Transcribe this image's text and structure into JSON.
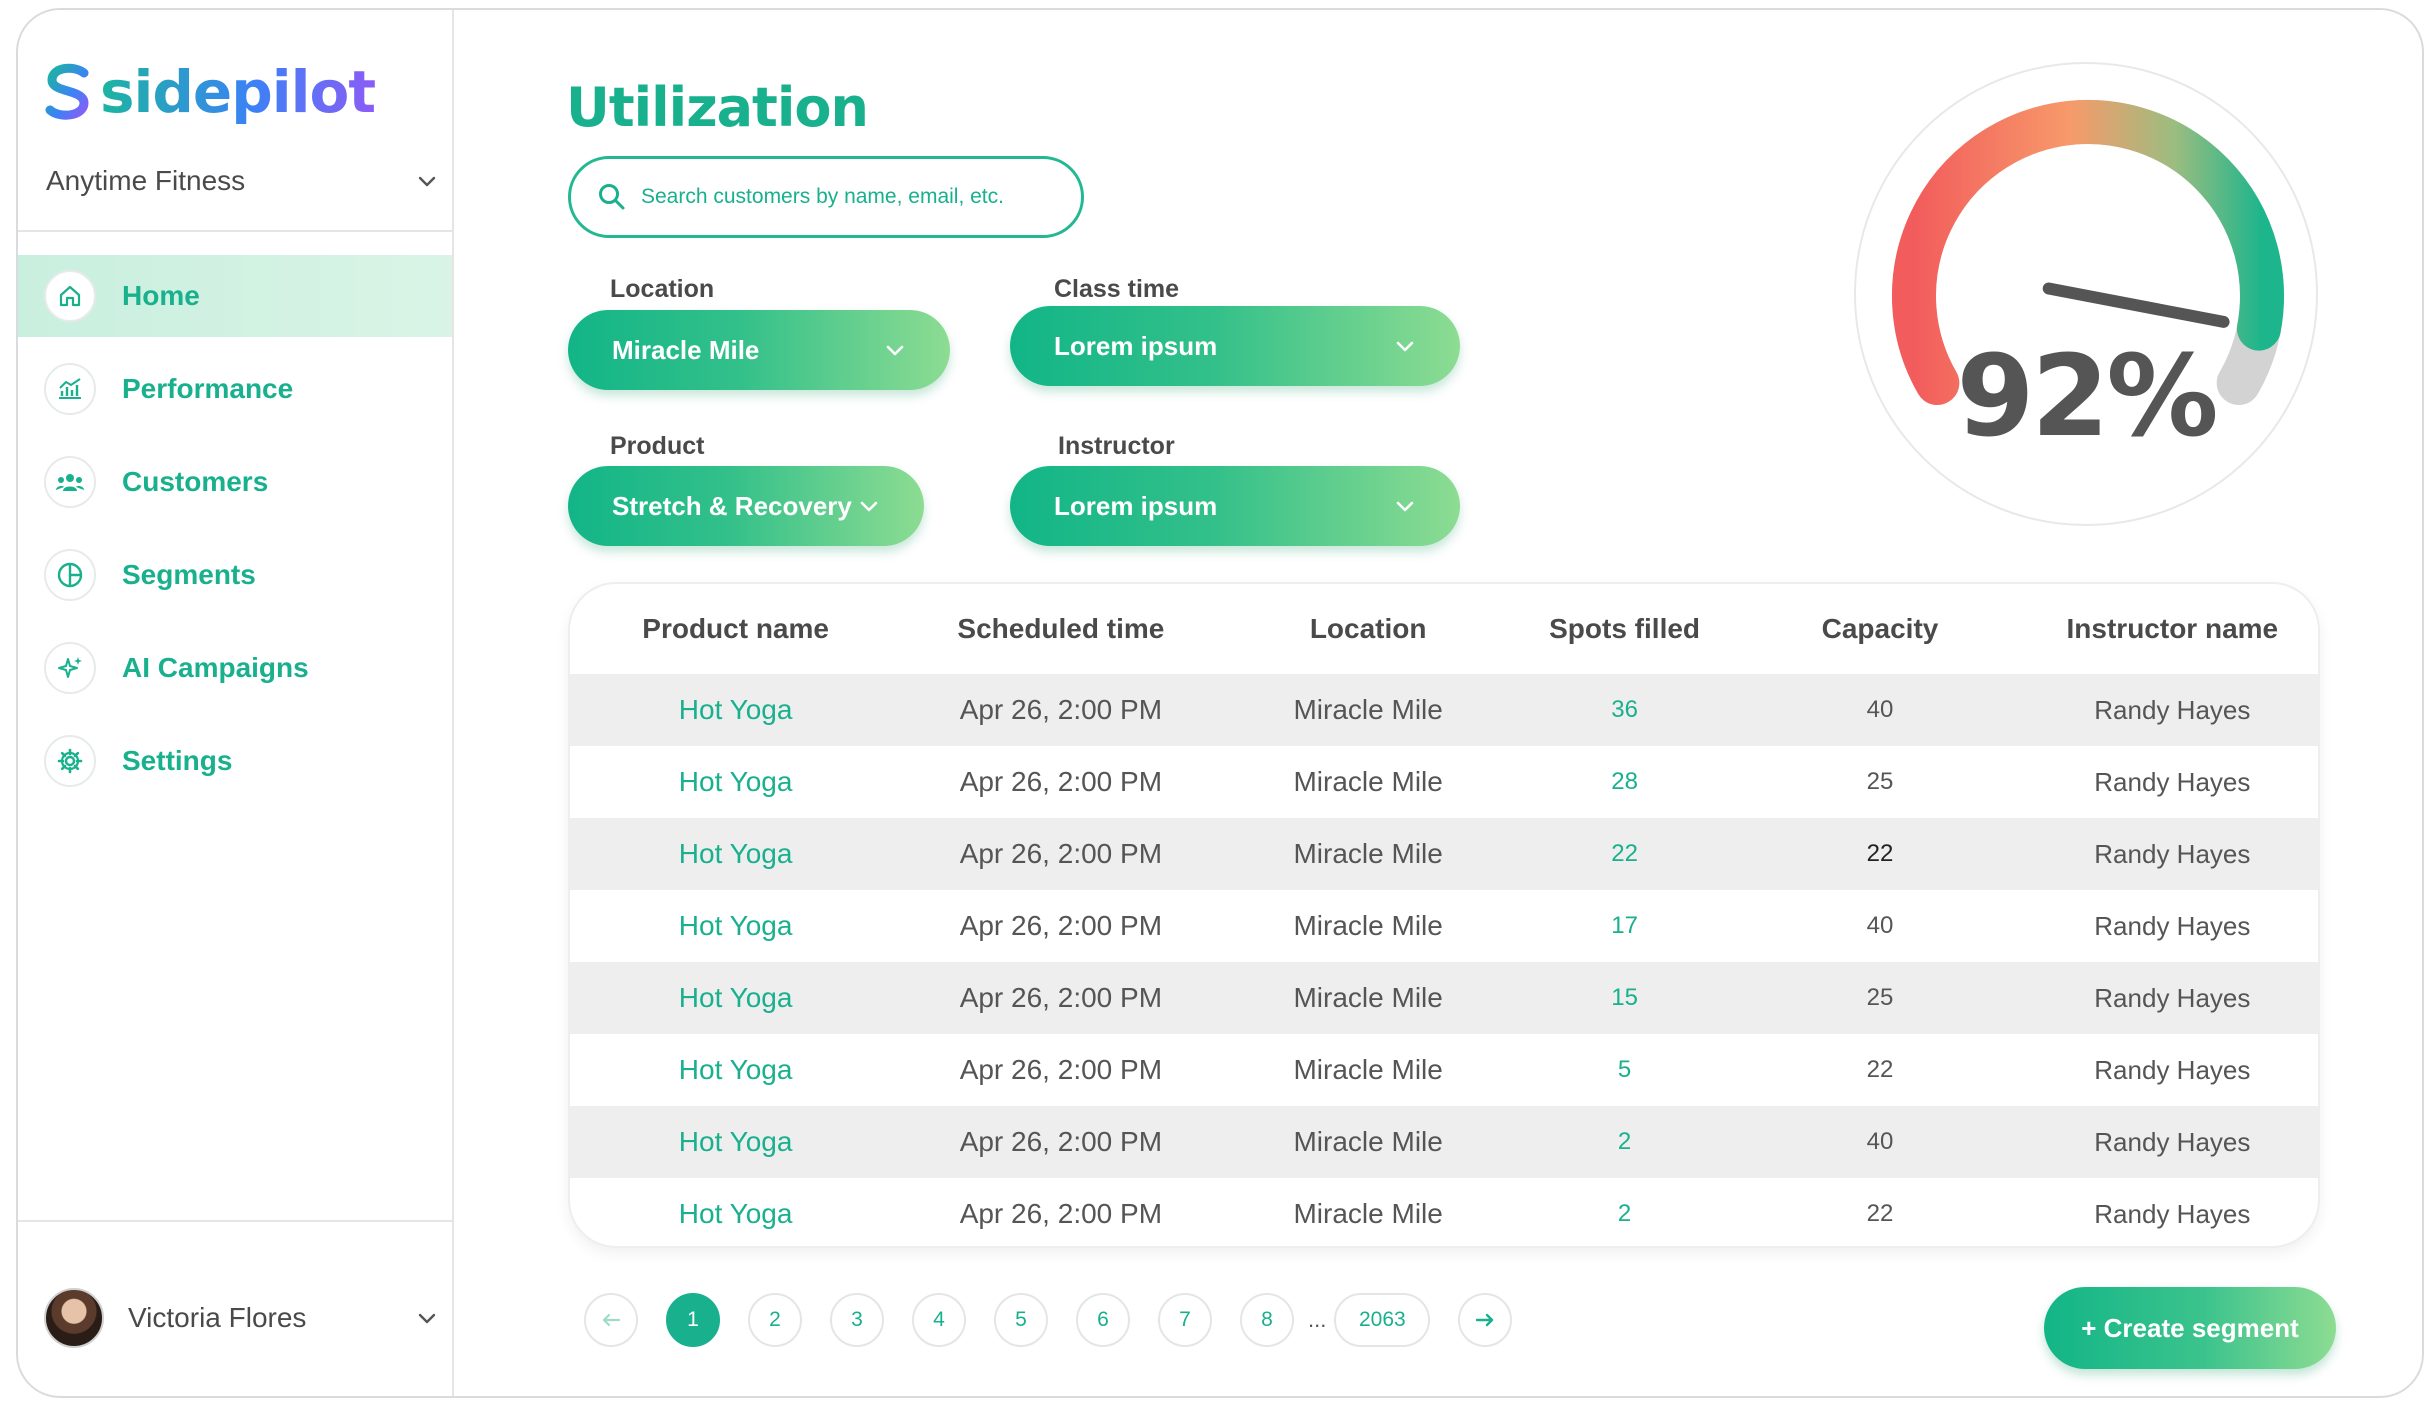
{
  "brand": {
    "name": "sidepilot",
    "org": "Anytime Fitness"
  },
  "nav": [
    {
      "label": "Home",
      "icon": "home-icon",
      "active": true
    },
    {
      "label": "Performance",
      "icon": "chart-icon",
      "active": false
    },
    {
      "label": "Customers",
      "icon": "users-icon",
      "active": false
    },
    {
      "label": "Segments",
      "icon": "pie-icon",
      "active": false
    },
    {
      "label": "AI Campaigns",
      "icon": "sparkle-icon",
      "active": false
    },
    {
      "label": "Settings",
      "icon": "gear-icon",
      "active": false
    }
  ],
  "user": {
    "name": "Victoria Flores"
  },
  "page": {
    "title": "Utilization"
  },
  "search": {
    "placeholder": "Search customers by name, email, etc."
  },
  "filters": {
    "location": {
      "label": "Location",
      "value": "Miracle Mile"
    },
    "class_time": {
      "label": "Class time",
      "value": "Lorem ipsum"
    },
    "product": {
      "label": "Product",
      "value": "Stretch & Recovery"
    },
    "instructor": {
      "label": "Instructor",
      "value": "Lorem ipsum"
    }
  },
  "gauge": {
    "value_text": "92%",
    "value": 0.92
  },
  "table": {
    "headers": [
      "Product name",
      "Scheduled time",
      "Location",
      "Spots filled",
      "Capacity",
      "Instructor name"
    ],
    "rows": [
      [
        "Hot Yoga",
        "Apr 26, 2:00 PM",
        "Miracle Mile",
        "36",
        "40",
        "Randy Hayes"
      ],
      [
        "Hot Yoga",
        "Apr 26, 2:00 PM",
        "Miracle Mile",
        "28",
        "25",
        "Randy Hayes"
      ],
      [
        "Hot Yoga",
        "Apr 26, 2:00 PM",
        "Miracle Mile",
        "22",
        "22",
        "Randy Hayes"
      ],
      [
        "Hot Yoga",
        "Apr 26, 2:00 PM",
        "Miracle Mile",
        "17",
        "40",
        "Randy Hayes"
      ],
      [
        "Hot Yoga",
        "Apr 26, 2:00 PM",
        "Miracle Mile",
        "15",
        "25",
        "Randy Hayes"
      ],
      [
        "Hot Yoga",
        "Apr 26, 2:00 PM",
        "Miracle Mile",
        "5",
        "22",
        "Randy Hayes"
      ],
      [
        "Hot Yoga",
        "Apr 26, 2:00 PM",
        "Miracle Mile",
        "2",
        "40",
        "Randy Hayes"
      ],
      [
        "Hot Yoga",
        "Apr 26, 2:00 PM",
        "Miracle Mile",
        "2",
        "22",
        "Randy Hayes"
      ]
    ]
  },
  "pagination": {
    "pages": [
      "1",
      "2",
      "3",
      "4",
      "5",
      "6",
      "7",
      "8"
    ],
    "ellipsis": "...",
    "last": "2063",
    "current": "1"
  },
  "actions": {
    "create_segment": "+ Create segment"
  },
  "colors": {
    "accent": "#19b08e",
    "gauge_red": "#f25c5c",
    "gauge_orange": "#f79a6a",
    "gauge_green": "#1db58c",
    "gauge_grey": "#d3d3d3"
  }
}
